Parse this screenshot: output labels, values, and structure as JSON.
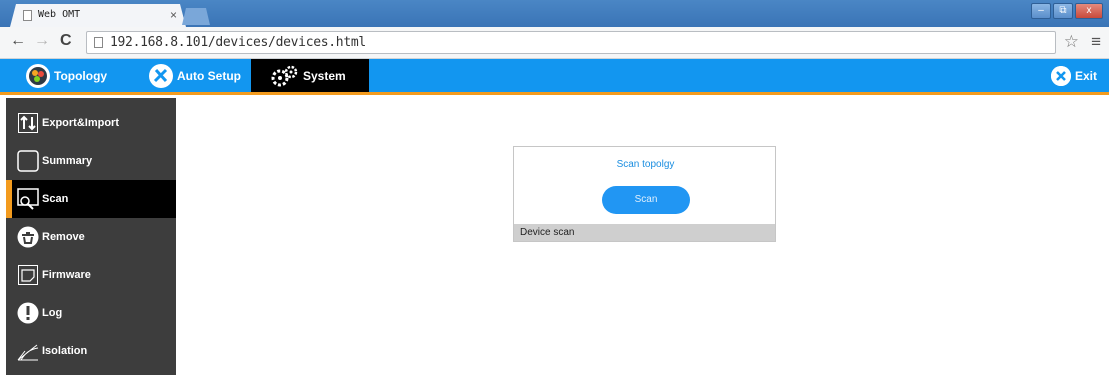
{
  "browser": {
    "tab_title": "Web OMT",
    "tab_close": "×",
    "url": "192.168.8.101/devices/devices.html",
    "window_buttons": {
      "minimize": "–",
      "maximize": "⧉",
      "close": "x"
    }
  },
  "topbar": {
    "items": [
      {
        "label": "Topology",
        "icon": "topology-icon"
      },
      {
        "label": "Auto Setup",
        "icon": "auto-setup-icon"
      },
      {
        "label": "System",
        "icon": "gears-icon",
        "active": true
      }
    ],
    "exit_label": "Exit",
    "accent_color": "#1296f0",
    "active_underline_color": "#f39b1e"
  },
  "sidebar": {
    "items": [
      {
        "label": "Export&Import",
        "icon": "export-import-icon"
      },
      {
        "label": "Summary",
        "icon": "summary-icon"
      },
      {
        "label": "Scan",
        "icon": "scan-icon",
        "active": true
      },
      {
        "label": "Remove",
        "icon": "remove-icon"
      },
      {
        "label": "Firmware",
        "icon": "firmware-icon"
      },
      {
        "label": "Log",
        "icon": "log-icon"
      },
      {
        "label": "Isolation",
        "icon": "isolation-icon"
      }
    ]
  },
  "main": {
    "panel_title": "Scan topolgy",
    "scan_button": "Scan",
    "footer": "Device scan"
  }
}
